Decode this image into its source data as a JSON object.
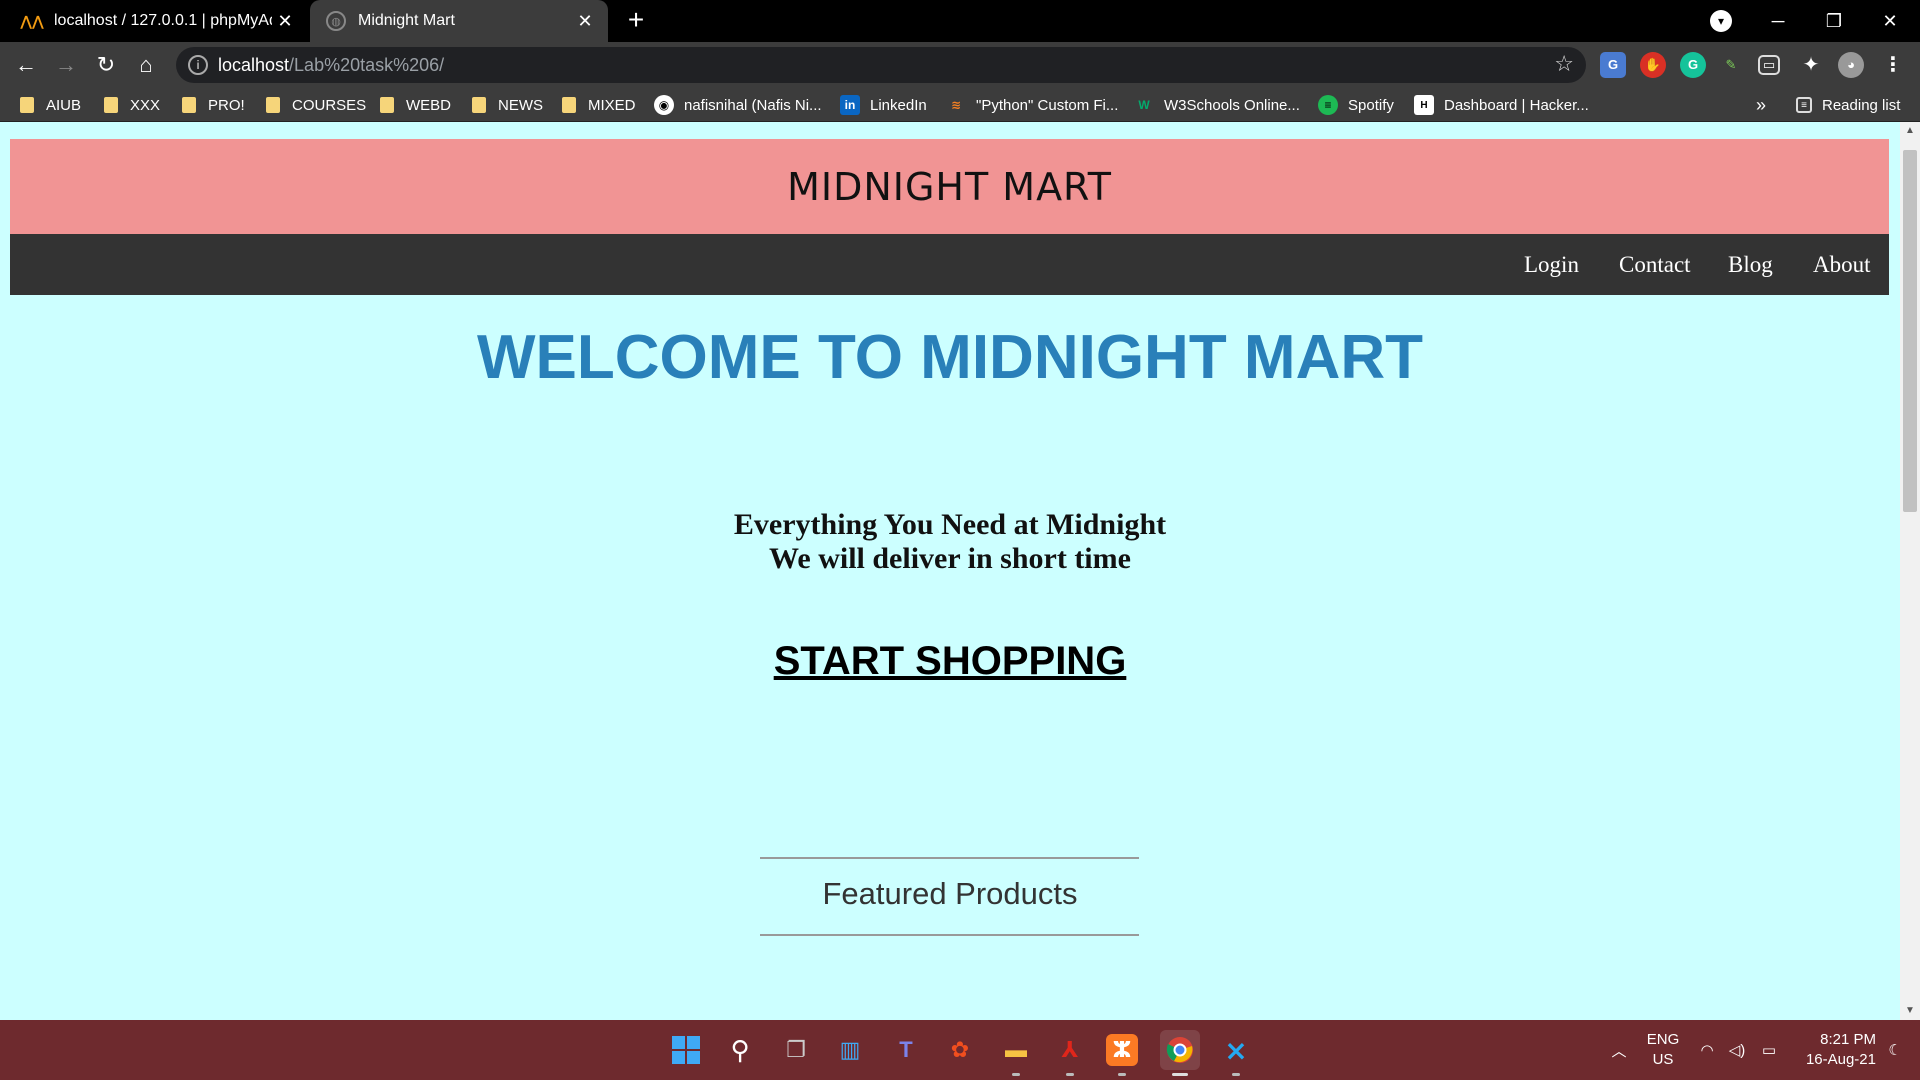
{
  "browser": {
    "tabs": [
      {
        "title": "localhost / 127.0.0.1 | phpMyAdn",
        "icon": "phpmyadmin-icon",
        "close": "✕"
      },
      {
        "title": "Midnight Mart",
        "icon": "globe-icon",
        "close": "✕"
      }
    ],
    "new_tab": "+",
    "window_controls": {
      "minimize": "─",
      "restore": "❐",
      "close": "✕"
    },
    "url_host": "localhost",
    "url_path": "/Lab%20task%206/",
    "bookmarks": [
      {
        "label": "AIUB",
        "type": "folder"
      },
      {
        "label": "XXX",
        "type": "folder"
      },
      {
        "label": "PRO!",
        "type": "folder"
      },
      {
        "label": "COURSES",
        "type": "folder"
      },
      {
        "label": "WEBD",
        "type": "folder"
      },
      {
        "label": "NEWS",
        "type": "folder"
      },
      {
        "label": "MIXED",
        "type": "folder"
      },
      {
        "label": "nafisnihal (Nafis Ni...",
        "type": "github-icon"
      },
      {
        "label": "LinkedIn",
        "type": "linkedin-icon"
      },
      {
        "label": "\"Python\" Custom Fi...",
        "type": "stackoverflow-icon"
      },
      {
        "label": "W3Schools Online...",
        "type": "w3schools-icon"
      },
      {
        "label": "Spotify",
        "type": "spotify-icon"
      },
      {
        "label": "Dashboard | Hacker...",
        "type": "hackerrank-icon"
      }
    ],
    "bookmarks_overflow": "»",
    "reading_list": "Reading list"
  },
  "page": {
    "brand": "MIDNIGHT MART",
    "nav": [
      "Login",
      "Contact",
      "Blog",
      "About"
    ],
    "welcome": "WELCOME TO MIDNIGHT MART",
    "tagline_1": "Everything You Need at Midnight",
    "tagline_2": "We will deliver in short time",
    "cta": "START SHOPPING",
    "featured": "Featured Products"
  },
  "taskbar": {
    "lang_1": "ENG",
    "lang_2": "US",
    "time": "8:21 PM",
    "date": "16-Aug-21"
  },
  "colors": {
    "header_bg": "#f19494",
    "nav_bg": "#333333",
    "page_bg": "#ccffff",
    "welcome_text": "#2980b9",
    "taskbar_bg": "#6e2a2e"
  }
}
